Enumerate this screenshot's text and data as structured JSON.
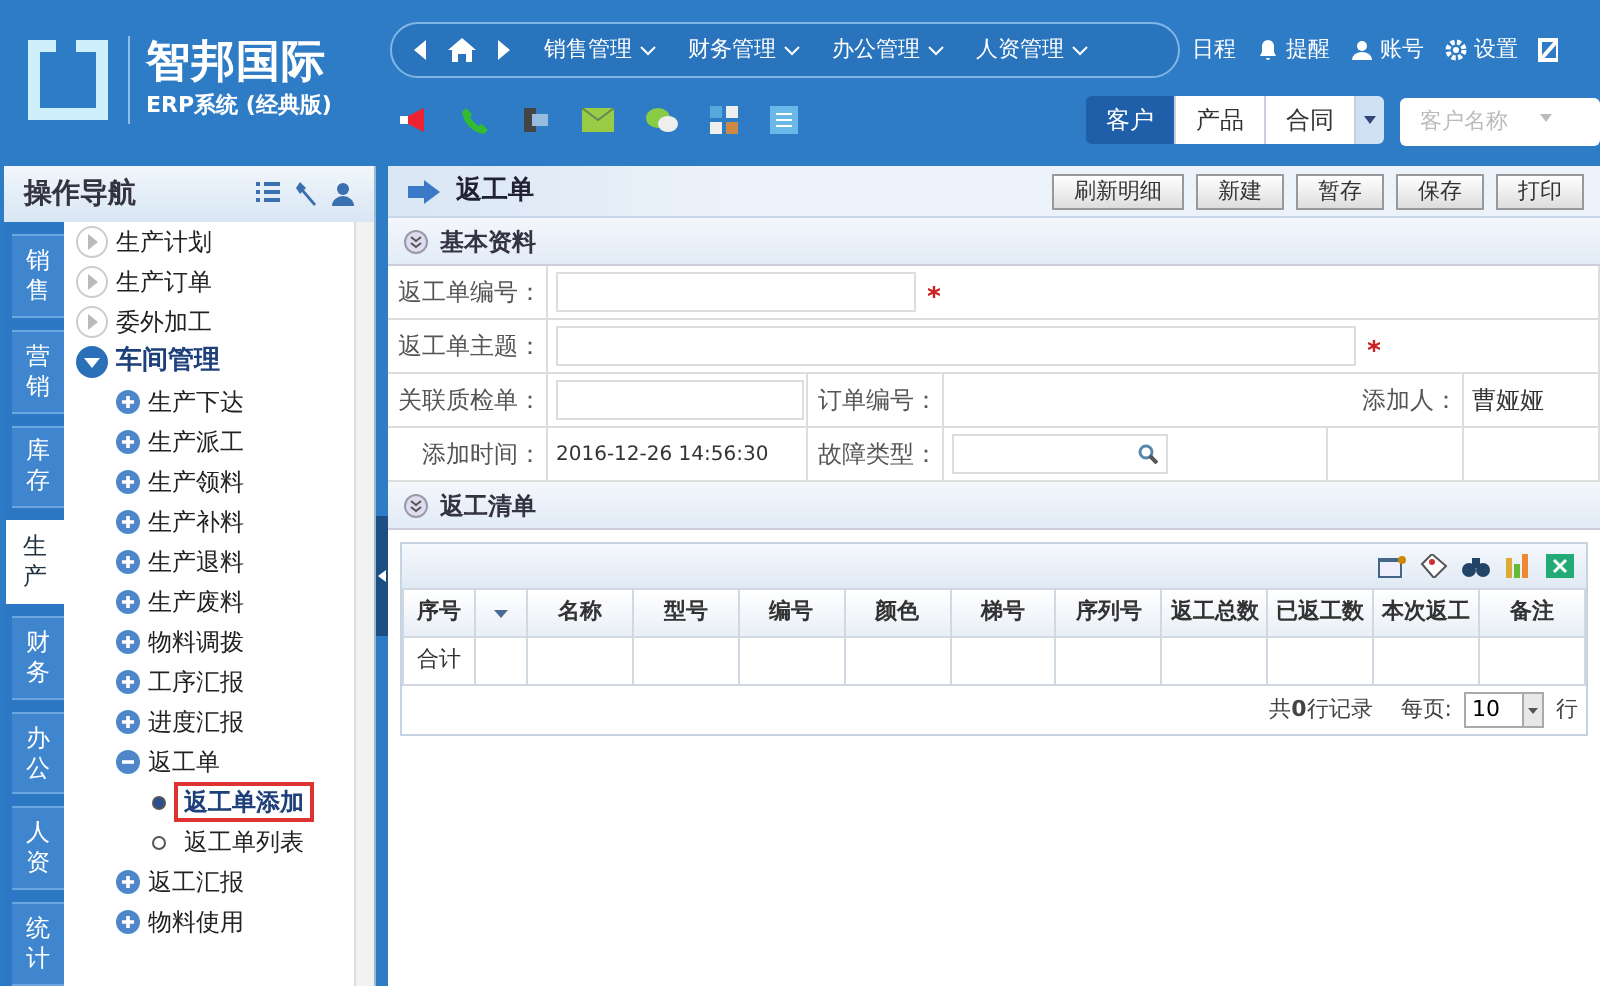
{
  "brand": {
    "title": "智邦国际",
    "subtitle": "ERP系统 (经典版)"
  },
  "nav_menus": [
    {
      "label": "销售管理"
    },
    {
      "label": "财务管理"
    },
    {
      "label": "办公管理"
    },
    {
      "label": "人资管理"
    }
  ],
  "top_links": [
    {
      "kind": "plain",
      "label": "日程"
    },
    {
      "kind": "bell",
      "label": "提醒"
    },
    {
      "kind": "user",
      "label": "账号"
    },
    {
      "kind": "gear",
      "label": "设置"
    }
  ],
  "quick_tabs": [
    {
      "label": "客户",
      "selected": true
    },
    {
      "label": "产品",
      "selected": false
    },
    {
      "label": "合同",
      "selected": false
    }
  ],
  "quick_search": {
    "placeholder": "客户名称"
  },
  "sidebar": {
    "title": "操作导航",
    "side_tabs": [
      {
        "label": "销售",
        "selected": false
      },
      {
        "label": "营销",
        "selected": false
      },
      {
        "label": "库存",
        "selected": false
      },
      {
        "label": "生产",
        "selected": true
      },
      {
        "label": "财务",
        "selected": false
      },
      {
        "label": "办公",
        "selected": false
      },
      {
        "label": "人资",
        "selected": false
      },
      {
        "label": "统计",
        "selected": false
      }
    ],
    "tree": [
      {
        "label": "生产计划",
        "expanded": false
      },
      {
        "label": "生产订单",
        "expanded": false
      },
      {
        "label": "委外加工",
        "expanded": false
      },
      {
        "label": "车间管理",
        "expanded": true,
        "children": [
          {
            "label": "生产下达",
            "expanded": false
          },
          {
            "label": "生产派工",
            "expanded": false
          },
          {
            "label": "生产领料",
            "expanded": false
          },
          {
            "label": "生产补料",
            "expanded": false
          },
          {
            "label": "生产退料",
            "expanded": false
          },
          {
            "label": "生产废料",
            "expanded": false
          },
          {
            "label": "物料调拨",
            "expanded": false
          },
          {
            "label": "工序汇报",
            "expanded": false
          },
          {
            "label": "进度汇报",
            "expanded": false
          },
          {
            "label": "返工单",
            "expanded": true,
            "children": [
              {
                "label": "返工单添加",
                "selected": true
              },
              {
                "label": "返工单列表",
                "selected": false
              }
            ]
          },
          {
            "label": "返工汇报",
            "expanded": false
          },
          {
            "label": "物料使用",
            "expanded": false
          }
        ]
      }
    ]
  },
  "page": {
    "title": "返工单",
    "buttons": [
      "刷新明细",
      "新建",
      "暂存",
      "保存",
      "打印"
    ]
  },
  "basic_section": {
    "title": "基本资料",
    "number_field": {
      "label": "返工单编号：",
      "required": true
    },
    "subject_field": {
      "label": "返工单主题：",
      "required": true
    },
    "inspection_field": {
      "label": "关联质检单："
    },
    "order_no": {
      "label": "订单编号："
    },
    "added_by": {
      "label": "添加人：",
      "value": "曹娅娅"
    },
    "added_time": {
      "label": "添加时间：",
      "value": "2016-12-26 14:56:30"
    },
    "fault_type": {
      "label": "故障类型："
    }
  },
  "list_section": {
    "title": "返工清单",
    "columns": [
      "序号",
      "",
      "名称",
      "型号",
      "编号",
      "颜色",
      "梯号",
      "序列号",
      "返工总数",
      "已返工数",
      "本次返工",
      "备注"
    ],
    "total_row": "合计",
    "record_count": "共**0**行记录",
    "per_page_label": "每页:",
    "per_page": "10",
    "per_page_unit": "行"
  }
}
